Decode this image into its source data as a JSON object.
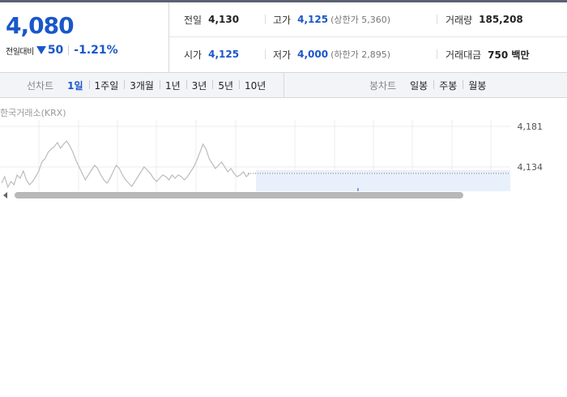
{
  "quote": {
    "price": "4,080",
    "change_label": "전일대비",
    "change_value": "50",
    "change_pct": "-1.21%",
    "prev_close_label": "전일",
    "prev_close": "4,130",
    "high_label": "고가",
    "high": "4,125",
    "upper_limit": "(상한가 5,360)",
    "volume_label": "거래량",
    "volume": "185,208",
    "open_label": "시가",
    "open": "4,125",
    "low_label": "저가",
    "low": "4,000",
    "lower_limit": "(하한가 2,895)",
    "amount_label": "거래대금",
    "amount": "750 백만"
  },
  "line_tabs": {
    "title": "선차트",
    "items": [
      "1일",
      "1주일",
      "3개월",
      "1년",
      "3년",
      "5년",
      "10년"
    ],
    "active": "1일"
  },
  "candle_tabs": {
    "title": "봉차트",
    "items": [
      "일봉",
      "주봉",
      "월봉"
    ]
  },
  "chart": {
    "source": "한국거래소(KRX)",
    "ytick_high": "4,181",
    "ytick_mid": "4,134"
  },
  "colors": {
    "accent": "#1a57c9",
    "down": "#1a57c9",
    "line": "#bcbcbc",
    "future_fill": "#e8f0fb"
  },
  "chart_data": {
    "type": "line",
    "title": "",
    "y_ticks": [
      4181,
      4134
    ],
    "ylim": [
      4110,
      4190
    ],
    "last_price": 4132,
    "values": [
      4120,
      4128,
      4115,
      4122,
      4118,
      4130,
      4126,
      4135,
      4124,
      4118,
      4122,
      4128,
      4135,
      4146,
      4150,
      4158,
      4162,
      4165,
      4170,
      4163,
      4168,
      4172,
      4166,
      4158,
      4148,
      4140,
      4132,
      4124,
      4130,
      4136,
      4142,
      4138,
      4130,
      4124,
      4120,
      4126,
      4134,
      4142,
      4138,
      4130,
      4124,
      4120,
      4116,
      4122,
      4128,
      4134,
      4140,
      4136,
      4132,
      4126,
      4122,
      4126,
      4130,
      4128,
      4124,
      4130,
      4126,
      4130,
      4128,
      4124,
      4128,
      4134,
      4140,
      4148,
      4158,
      4168,
      4162,
      4150,
      4144,
      4138,
      4142,
      4146,
      4140,
      4134,
      4138,
      4132,
      4128,
      4130,
      4134,
      4128,
      4132
    ]
  }
}
